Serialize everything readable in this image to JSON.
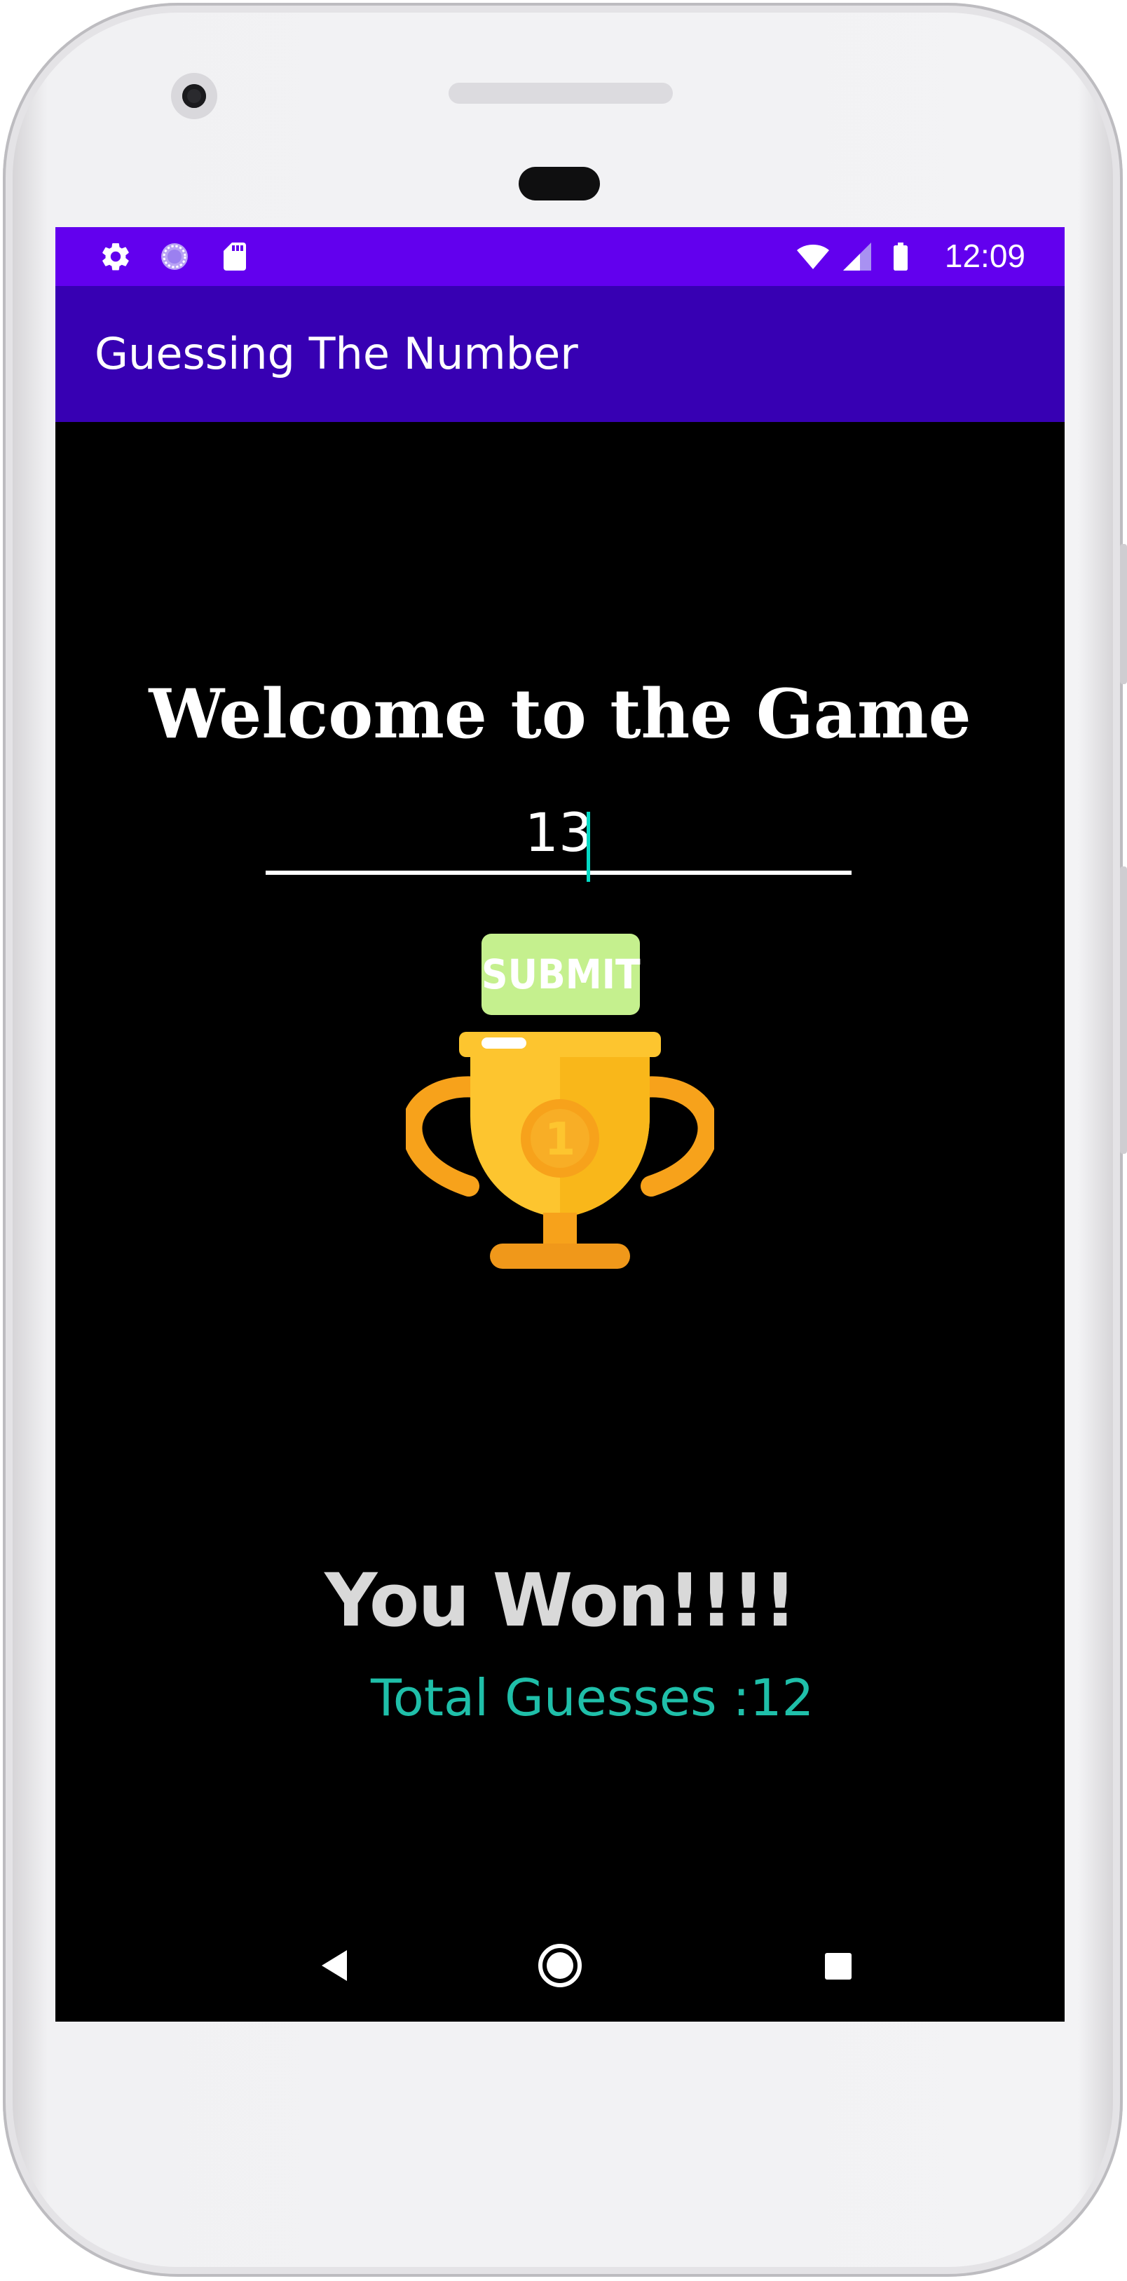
{
  "status_bar": {
    "time": "12:09",
    "left_icons": [
      "settings-icon",
      "loading-circle-icon",
      "sd-card-icon"
    ],
    "right_icons": [
      "wifi-icon",
      "signal-icon",
      "battery-icon"
    ],
    "color": "#6200ee"
  },
  "app_bar": {
    "title": "Guessing The Number",
    "color": "#3700b3"
  },
  "main": {
    "welcome_text": "Welcome to the Game",
    "guess_input_value": "13",
    "submit_label": "SUBMIT",
    "trophy_icon": "trophy-icon",
    "trophy_number": "1",
    "result_text": "You Won!!!!",
    "total_guesses_text": "Total Guesses :12",
    "accent_color": "#03dac5",
    "submit_color": "#c5f08e",
    "guesses_color": "#1fbfa9"
  },
  "nav_bar": {
    "buttons": [
      "back-icon",
      "home-icon",
      "recents-icon"
    ]
  }
}
